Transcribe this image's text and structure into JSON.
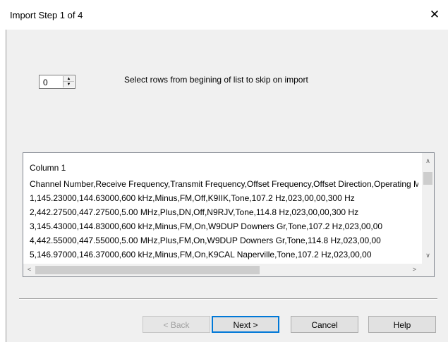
{
  "window": {
    "title": "Import Step 1 of 4",
    "close_glyph": "✕"
  },
  "skip": {
    "value": "0",
    "label": "Select rows from begining of list to skip on import",
    "up_glyph": "▲",
    "down_glyph": "▼"
  },
  "list": {
    "lines": [
      "Column 1",
      "Channel Number,Receive Frequency,Transmit Frequency,Offset Frequency,Offset Direction,Operating Mode",
      "1,145.23000,144.63000,600 kHz,Minus,FM,Off,K9IIK,Tone,107.2 Hz,023,00,00,300 Hz",
      "2,442.27500,447.27500,5.00 MHz,Plus,DN,Off,N9RJV,Tone,114.8 Hz,023,00,00,300 Hz",
      "3,145.43000,144.83000,600 kHz,Minus,FM,On,W9DUP Downers Gr,Tone,107.2 Hz,023,00,00",
      "4,442.55000,447.55000,5.00 MHz,Plus,FM,On,W9DUP Downers Gr,Tone,114.8 Hz,023,00,00",
      "5,146.97000,146.37000,600 kHz,Minus,FM,On,K9CAL Naperville,Tone,107.2 Hz,023,00,00"
    ],
    "scroll_up_glyph": "∧",
    "scroll_down_glyph": "∨",
    "scroll_left_glyph": "<",
    "scroll_right_glyph": ">"
  },
  "buttons": {
    "back": "< Back",
    "next": "Next >",
    "cancel": "Cancel",
    "help": "Help"
  }
}
